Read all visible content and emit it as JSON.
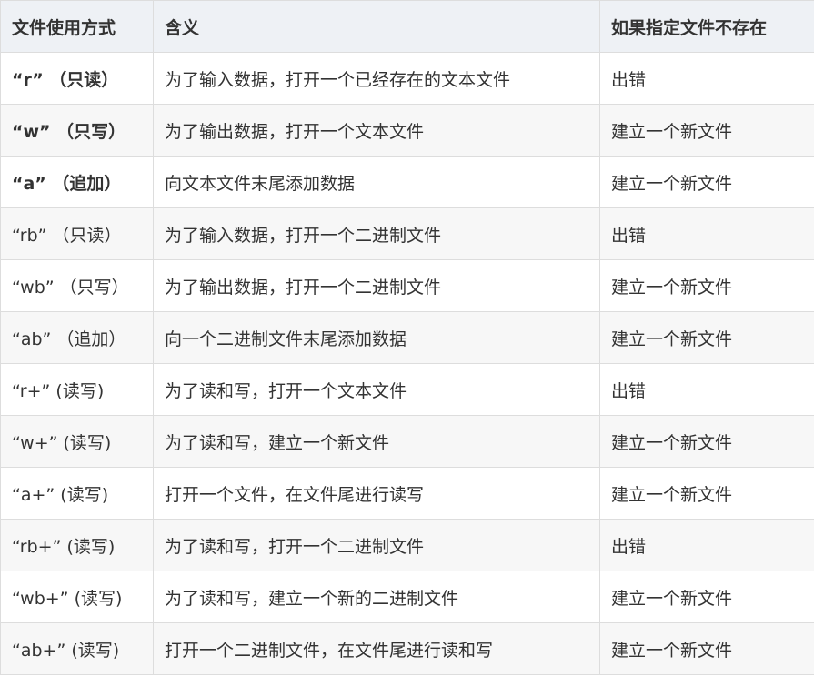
{
  "table": {
    "headers": [
      "文件使用方式",
      "含义",
      "如果指定文件不存在"
    ],
    "rows": [
      {
        "mode": "“r” （只读）",
        "meaning": "为了输入数据，打开一个已经存在的文本文件",
        "if_missing": "出错",
        "bold": true
      },
      {
        "mode": "“w” （只写）",
        "meaning": "为了输出数据，打开一个文本文件",
        "if_missing": "建立一个新文件",
        "bold": true
      },
      {
        "mode": "“a” （追加）",
        "meaning": "向文本文件末尾添加数据",
        "if_missing": "建立一个新文件",
        "bold": true
      },
      {
        "mode": "“rb” （只读）",
        "meaning": "为了输入数据，打开一个二进制文件",
        "if_missing": "出错",
        "bold": false
      },
      {
        "mode": "“wb” （只写）",
        "meaning": "为了输出数据，打开一个二进制文件",
        "if_missing": "建立一个新文件",
        "bold": false
      },
      {
        "mode": "“ab” （追加）",
        "meaning": "向一个二进制文件末尾添加数据",
        "if_missing": "建立一个新文件",
        "bold": false
      },
      {
        "mode": "“r+” (读写)",
        "meaning": "为了读和写，打开一个文本文件",
        "if_missing": "出错",
        "bold": false
      },
      {
        "mode": "“w+” (读写)",
        "meaning": "为了读和写，建立一个新文件",
        "if_missing": "建立一个新文件",
        "bold": false
      },
      {
        "mode": "“a+” (读写)",
        "meaning": "打开一个文件，在文件尾进行读写",
        "if_missing": "建立一个新文件",
        "bold": false
      },
      {
        "mode": "“rb+” (读写)",
        "meaning": "为了读和写，打开一个二进制文件",
        "if_missing": "出错",
        "bold": false
      },
      {
        "mode": "“wb+” (读写)",
        "meaning": "为了读和写，建立一个新的二进制文件",
        "if_missing": "建立一个新文件",
        "bold": false
      },
      {
        "mode": "“ab+” (读写)",
        "meaning": "打开一个二进制文件，在文件尾进行读和写",
        "if_missing": "建立一个新文件",
        "bold": false
      }
    ]
  }
}
